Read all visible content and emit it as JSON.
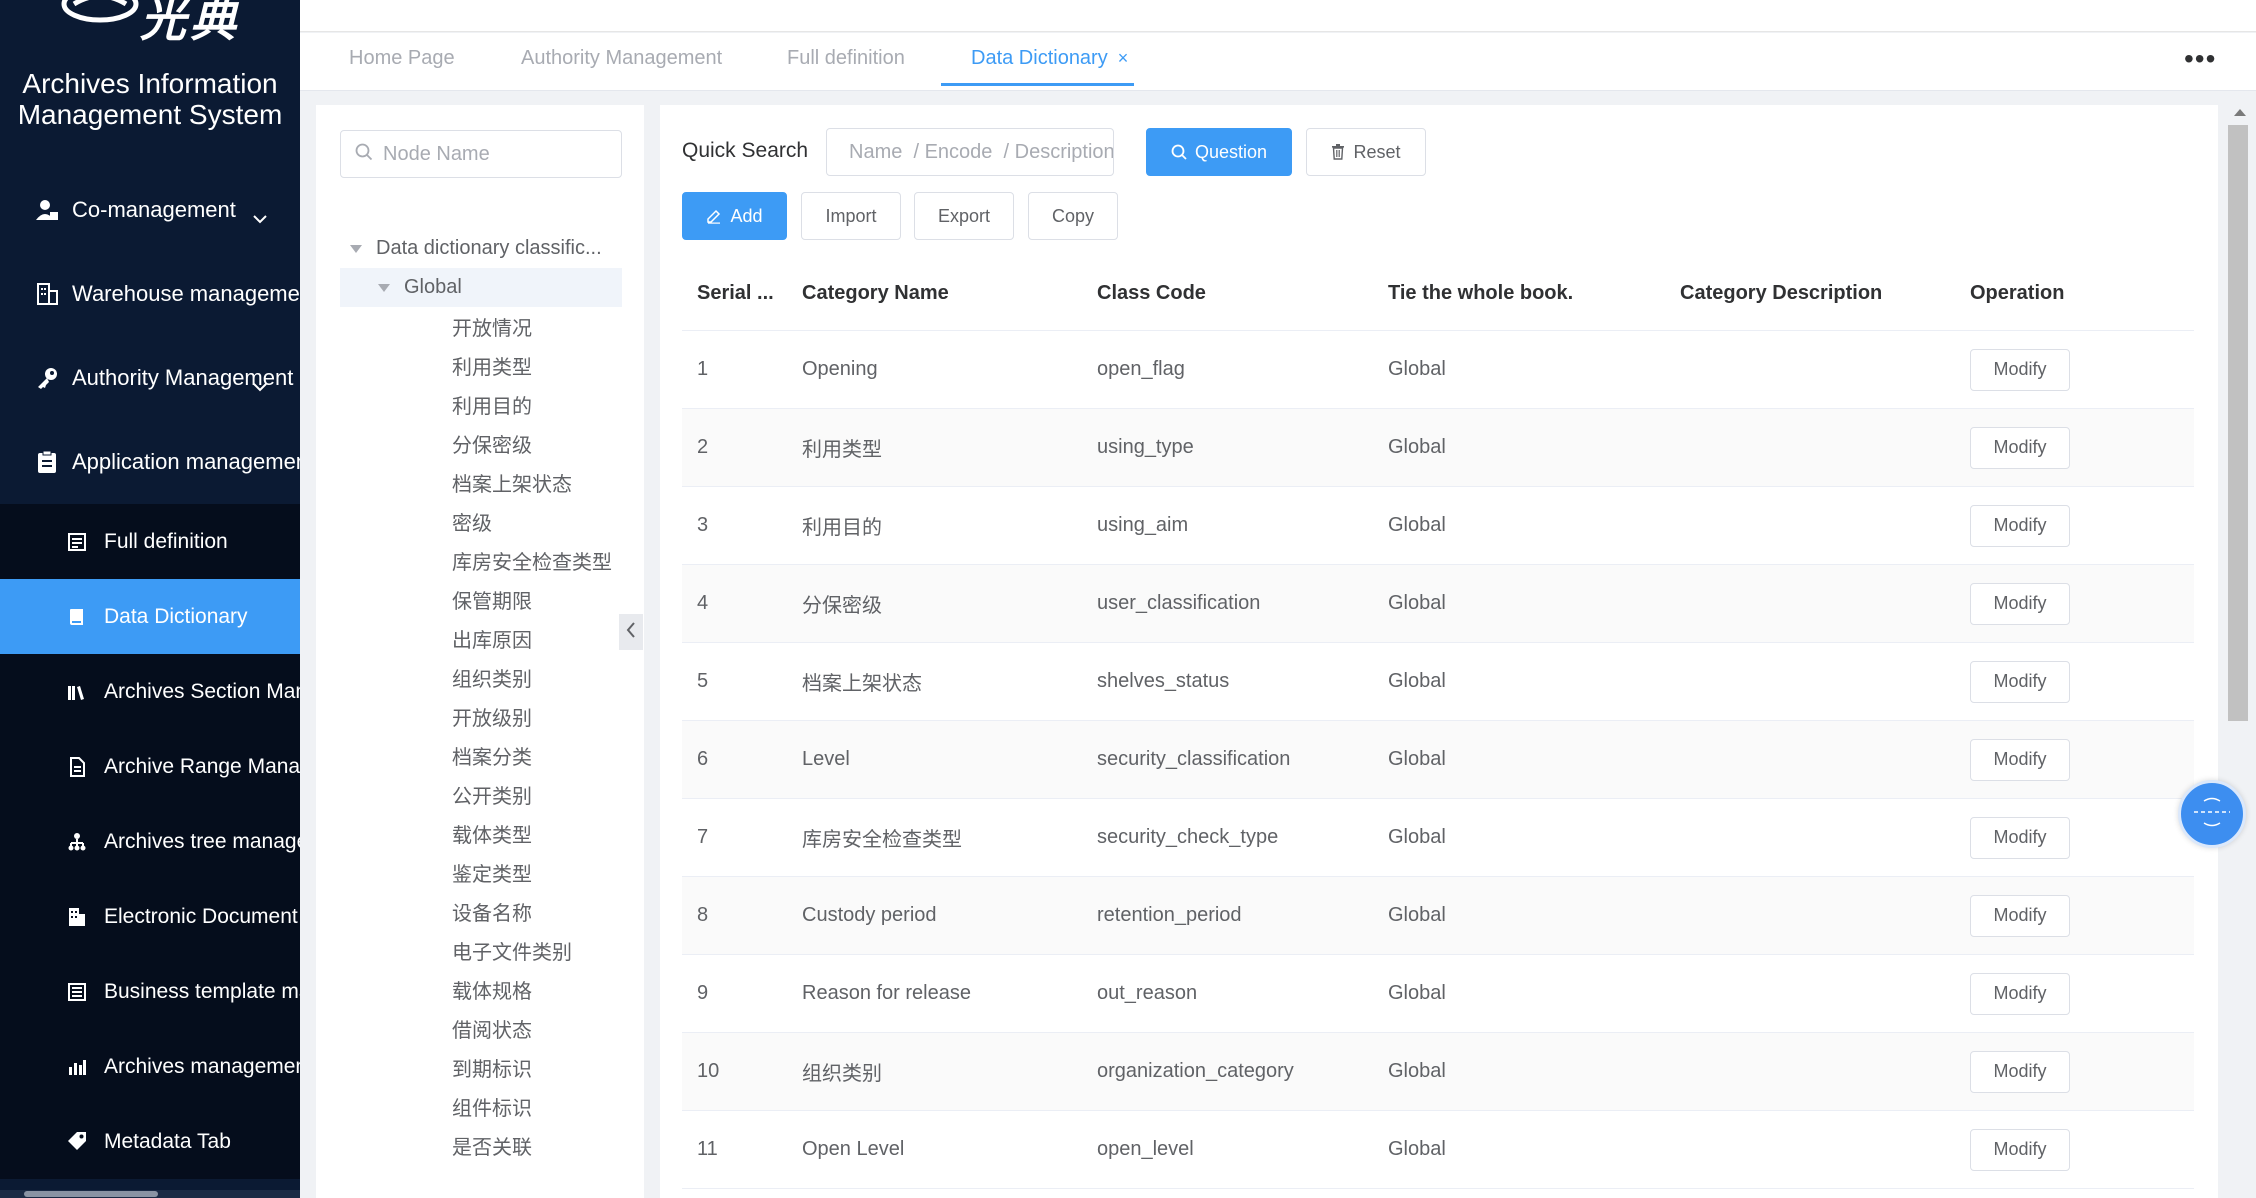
{
  "app": {
    "logo_text": "光典",
    "title_line1": "Archives Information",
    "title_line2": "Management System"
  },
  "sidebar": {
    "menu": [
      {
        "label": "Co-management",
        "icon": "user-group-icon",
        "has_caret": true
      },
      {
        "label": "Warehouse management",
        "icon": "building-icon",
        "has_caret": false
      },
      {
        "label": "Authority Management",
        "icon": "key-icon",
        "has_caret": true
      },
      {
        "label": "Application management",
        "icon": "clipboard-icon",
        "has_caret": false
      }
    ],
    "submenu": [
      {
        "label": "Full definition",
        "icon": "list-icon",
        "active": false
      },
      {
        "label": "Data Dictionary",
        "icon": "book-icon",
        "active": true
      },
      {
        "label": "Archives Section Management",
        "icon": "books-icon",
        "active": false
      },
      {
        "label": "Archive Range Management",
        "icon": "document-icon",
        "active": false
      },
      {
        "label": "Archives tree management",
        "icon": "tree-icon",
        "active": false
      },
      {
        "label": "Electronic Document Management",
        "icon": "building-icon",
        "active": false
      },
      {
        "label": "Business template management",
        "icon": "template-icon",
        "active": false
      },
      {
        "label": "Archives management",
        "icon": "bar-chart-icon",
        "active": false
      },
      {
        "label": "Metadata Tab",
        "icon": "tag-icon",
        "active": false
      }
    ]
  },
  "tabs": [
    {
      "label": "Home Page",
      "active": false
    },
    {
      "label": "Authority Management",
      "active": false
    },
    {
      "label": "Full definition",
      "active": false
    },
    {
      "label": "Data Dictionary",
      "active": true,
      "closable": true,
      "close_glyph": "×"
    }
  ],
  "more_glyph": "•••",
  "tree": {
    "search_placeholder": "Node Name",
    "root_label": "Data dictionary classific...",
    "global_label": "Global",
    "leaves": [
      "开放情况",
      "利用类型",
      "利用目的",
      "分保密级",
      "档案上架状态",
      "密级",
      "库房安全检查类型",
      "保管期限",
      "出库原因",
      "组织类别",
      "开放级别",
      "档案分类",
      "公开类别",
      "载体类型",
      "鉴定类型",
      "设备名称",
      "电子文件类别",
      "载体规格",
      "借阅状态",
      "到期标识",
      "组件标识",
      "是否关联"
    ]
  },
  "toolbar": {
    "quick_search_label": "Quick Search",
    "search_placeholder": "Name  / Encode  / Description",
    "question_label": "Question",
    "reset_label": "Reset",
    "add_label": "Add",
    "import_label": "Import",
    "export_label": "Export",
    "copy_label": "Copy"
  },
  "table": {
    "headers": [
      "Serial ...",
      "Category Name",
      "Class Code",
      "Tie the whole book.",
      "Category Description",
      "Operation"
    ],
    "modify_label": "Modify",
    "rows": [
      {
        "serial": "1",
        "name": "Opening",
        "code": "open_flag",
        "tie": "Global",
        "desc": ""
      },
      {
        "serial": "2",
        "name": "利用类型",
        "code": "using_type",
        "tie": "Global",
        "desc": ""
      },
      {
        "serial": "3",
        "name": "利用目的",
        "code": "using_aim",
        "tie": "Global",
        "desc": ""
      },
      {
        "serial": "4",
        "name": "分保密级",
        "code": "user_classification",
        "tie": "Global",
        "desc": ""
      },
      {
        "serial": "5",
        "name": "档案上架状态",
        "code": "shelves_status",
        "tie": "Global",
        "desc": ""
      },
      {
        "serial": "6",
        "name": "Level",
        "code": "security_classification",
        "tie": "Global",
        "desc": ""
      },
      {
        "serial": "7",
        "name": "库房安全检查类型",
        "code": "security_check_type",
        "tie": "Global",
        "desc": ""
      },
      {
        "serial": "8",
        "name": "Custody period",
        "code": "retention_period",
        "tie": "Global",
        "desc": ""
      },
      {
        "serial": "9",
        "name": "Reason for release",
        "code": "out_reason",
        "tie": "Global",
        "desc": ""
      },
      {
        "serial": "10",
        "name": "组织类别",
        "code": "organization_category",
        "tie": "Global",
        "desc": ""
      },
      {
        "serial": "11",
        "name": "Open Level",
        "code": "open_level",
        "tie": "Global",
        "desc": ""
      }
    ]
  },
  "colors": {
    "sidebar_bg": "#0b1a33",
    "submenu_bg": "#050d1c",
    "accent": "#3d9bf5"
  }
}
